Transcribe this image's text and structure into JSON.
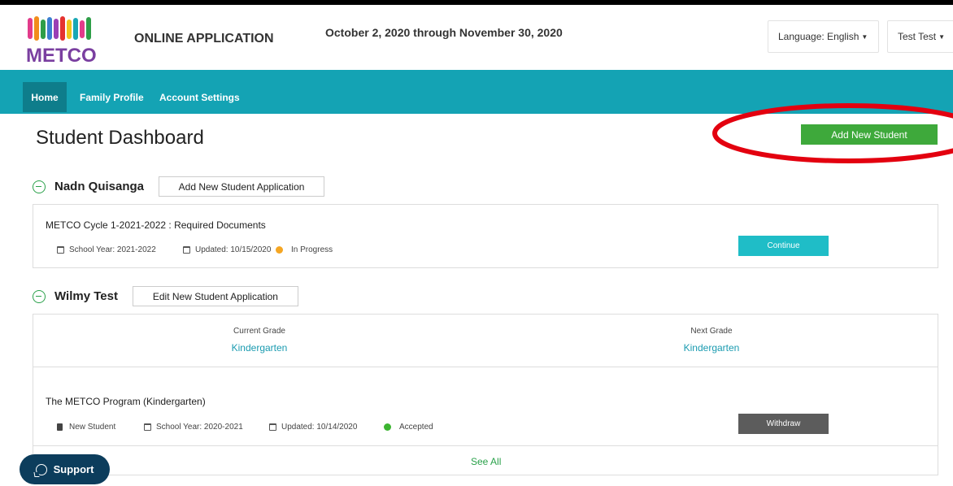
{
  "header": {
    "logo_text": "METCO",
    "app_title": "ONLINE APPLICATION",
    "date_range": "October 2, 2020 through November 30, 2020",
    "language_label": "Language: English",
    "user_label": "Test Test"
  },
  "nav": {
    "items": [
      {
        "label": "Home"
      },
      {
        "label": "Family Profile"
      },
      {
        "label": "Account Settings"
      }
    ]
  },
  "page": {
    "title": "Student Dashboard",
    "add_student_label": "Add New Student"
  },
  "students": [
    {
      "name": "Nadn Quisanga",
      "action_label": "Add New Student Application",
      "application": {
        "title": "METCO Cycle 1-2021-2022 : Required Documents",
        "school_year": "School Year: 2021-2022",
        "updated": "Updated: 10/15/2020",
        "status": "In Progress",
        "status_color": "#f5a623",
        "button_label": "Continue"
      }
    },
    {
      "name": "Wilmy Test",
      "action_label": "Edit New Student Application",
      "current_grade_label": "Current Grade",
      "current_grade": "Kindergarten",
      "next_grade_label": "Next Grade",
      "next_grade": "Kindergarten",
      "application": {
        "title": "The METCO Program (Kindergarten)",
        "type": "New Student",
        "school_year": "School Year: 2020-2021",
        "updated": "Updated: 10/14/2020",
        "status": "Accepted",
        "status_color": "#3cb531",
        "button_label": "Withdraw"
      },
      "see_all_label": "See All"
    }
  ],
  "support": {
    "label": "Support"
  },
  "colors": {
    "nav": "#14a3b4",
    "accent_green": "#3ea93b",
    "continue": "#1fbdc7",
    "annotation": "#e3000f"
  }
}
